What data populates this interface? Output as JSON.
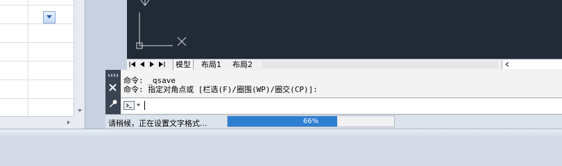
{
  "layout_tabs": {
    "model": "模型",
    "layout1": "布局1",
    "layout2": "布局2"
  },
  "command_history": [
    "命令: _qsave",
    "命令: 指定对角点或 [栏选(F)/圈围(WP)/圈交(CP)]:"
  ],
  "status": {
    "message": "请稍候，正在设置文字格式...",
    "progress_label": "66%",
    "progress_value": 0.66
  },
  "colors": {
    "canvas_bg": "#222a35",
    "progress_fill": "#2f7fd1",
    "cmd_side": "#3a4452"
  },
  "icons": {
    "ucs": "ucs-icon",
    "close": "close-icon",
    "wrench": "wrench-icon",
    "prompt": "command-prompt-icon"
  }
}
